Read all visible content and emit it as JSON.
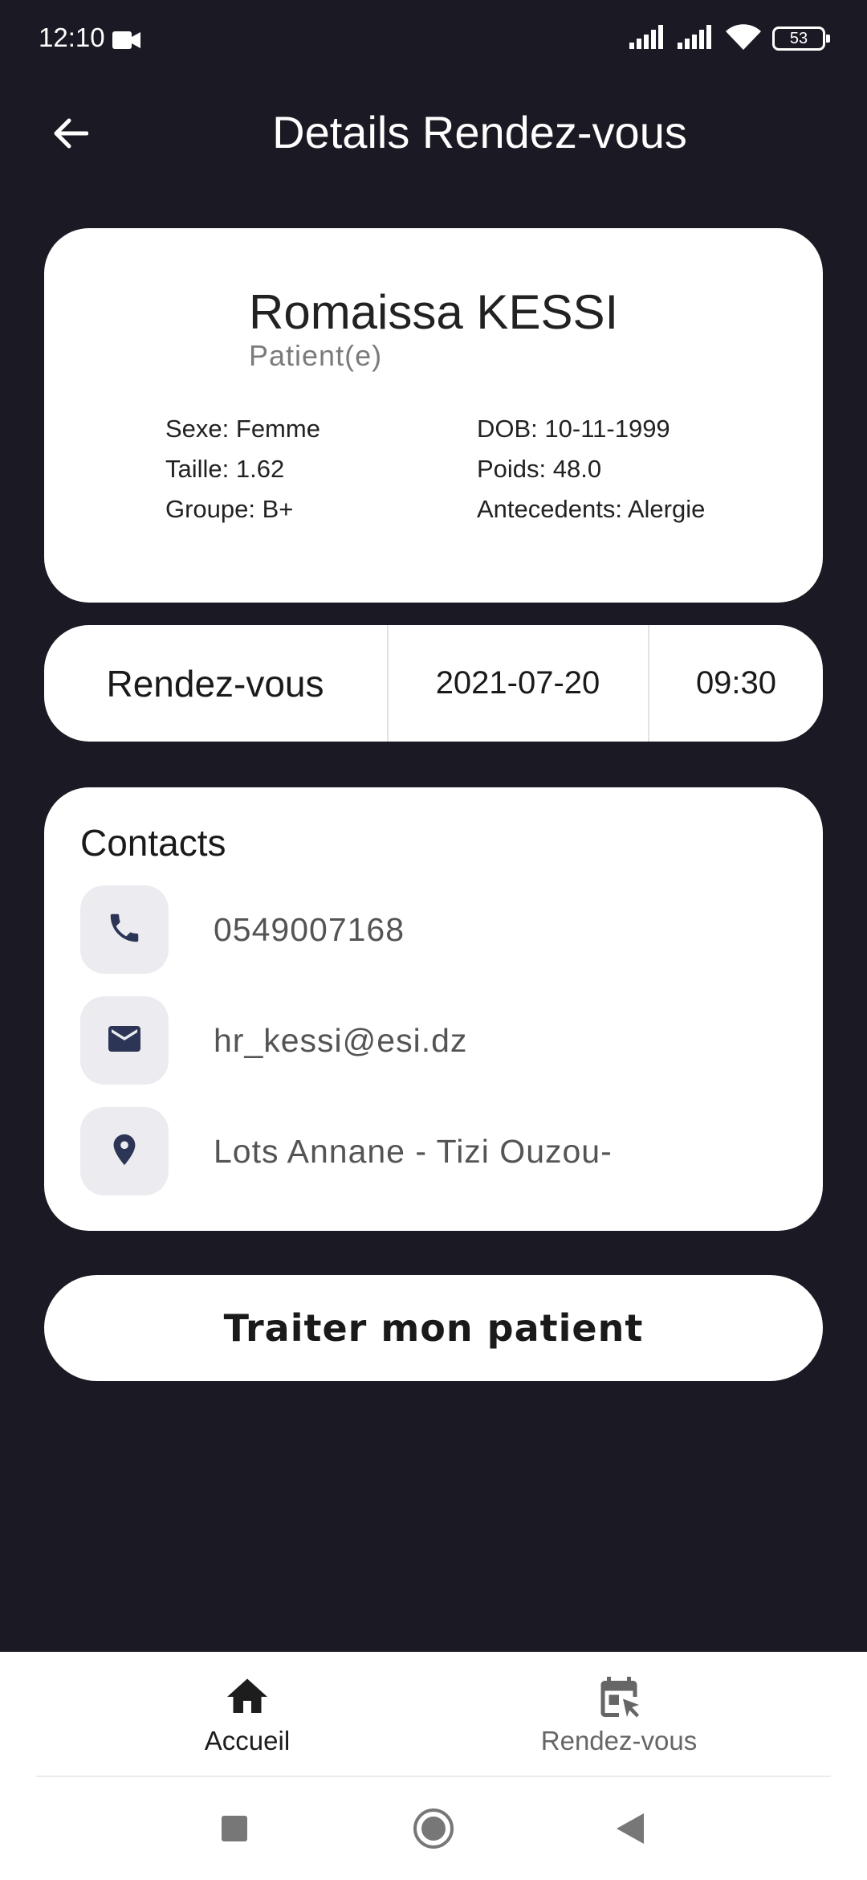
{
  "status_bar": {
    "time": "12:10",
    "battery": "53",
    "icons": [
      "video-camera-icon",
      "signal-icon",
      "signal-icon",
      "wifi-icon",
      "battery-icon"
    ]
  },
  "header": {
    "title": "Details Rendez-vous",
    "back_icon": "arrow-back-icon"
  },
  "patient": {
    "name": "Romaissa KESSI",
    "role": "Patient(e)",
    "sexe": "Sexe: Femme",
    "dob": "DOB: 10-11-1999",
    "taille": "Taille: 1.62",
    "poids": "Poids: 48.0",
    "groupe": "Groupe: B+",
    "antecedents": "Antecedents: Alergie"
  },
  "appointment": {
    "label": "Rendez-vous",
    "date": "2021-07-20",
    "time": "09:30"
  },
  "contacts": {
    "title": "Contacts",
    "items": [
      {
        "icon": "phone-icon",
        "value": "0549007168"
      },
      {
        "icon": "email-icon",
        "value": "hr_kessi@esi.dz"
      },
      {
        "icon": "location-pin-icon",
        "value": "Lots Annane - Tizi Ouzou-"
      }
    ]
  },
  "primary_action": {
    "label": "Traiter mon patient"
  },
  "bottom_nav": {
    "items": [
      {
        "icon": "home-icon",
        "label": "Accueil",
        "active": true
      },
      {
        "icon": "calendar-icon",
        "label": "Rendez-vous",
        "active": false
      }
    ]
  },
  "system_nav": {
    "icons": [
      "recents-square-icon",
      "home-circle-icon",
      "back-triangle-icon"
    ]
  },
  "colors": {
    "background": "#1b1a24",
    "card": "#ffffff",
    "icon_accent": "#2d3556",
    "icon_box": "#ececf0"
  }
}
